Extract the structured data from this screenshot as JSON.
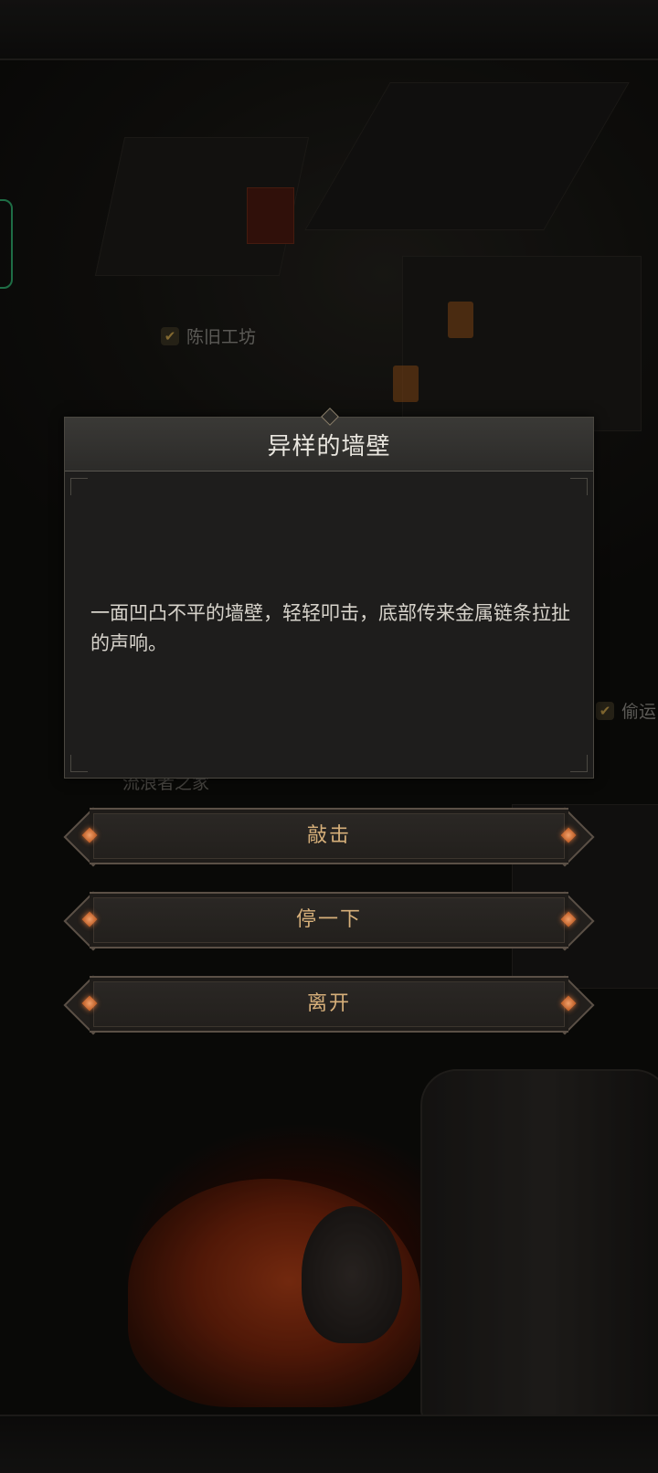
{
  "map": {
    "labels": [
      {
        "text": "陈旧工坊",
        "checked": true
      },
      {
        "text": "偷运",
        "checked": true
      }
    ],
    "partial_label": "流浪者之家"
  },
  "dialog": {
    "title": "异样的墙壁",
    "body": "一面凹凸不平的墙壁，轻轻叩击，底部传来金属链条拉扯的声响。"
  },
  "choices": [
    {
      "label": "敲击"
    },
    {
      "label": "停一下"
    },
    {
      "label": "离开"
    }
  ],
  "colors": {
    "accent_text": "#d7b07a",
    "gem": "#d9733a",
    "side_tab": "#2fa86a"
  }
}
